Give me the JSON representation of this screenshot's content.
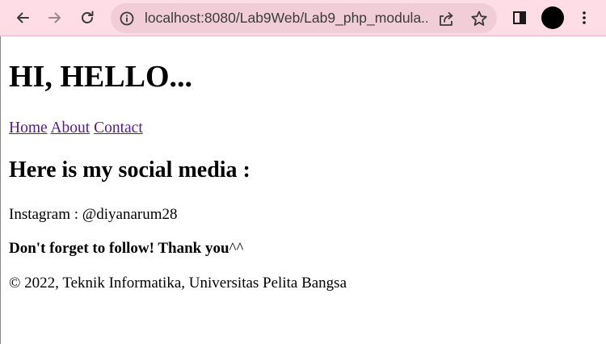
{
  "browser": {
    "url": "localhost:8080/Lab9Web/Lab9_php_modula...",
    "colors": {
      "toolbar": "#ffdde6",
      "omnibox": "#f1cdd8",
      "profile": "#000000"
    }
  },
  "page": {
    "heading": "HI, HELLO...",
    "nav": [
      {
        "label": "Home"
      },
      {
        "label": "About"
      },
      {
        "label": "Contact"
      }
    ],
    "subheading": "Here is my social media :",
    "instagram": "Instagram : @diyanarum28",
    "follow_bold": "Don't forget to follow! Thank you",
    "follow_rest": "^^",
    "footer": "© 2022, Teknik Informatika, Universitas Pelita Bangsa",
    "colors": {
      "link": "#551a8b"
    }
  }
}
